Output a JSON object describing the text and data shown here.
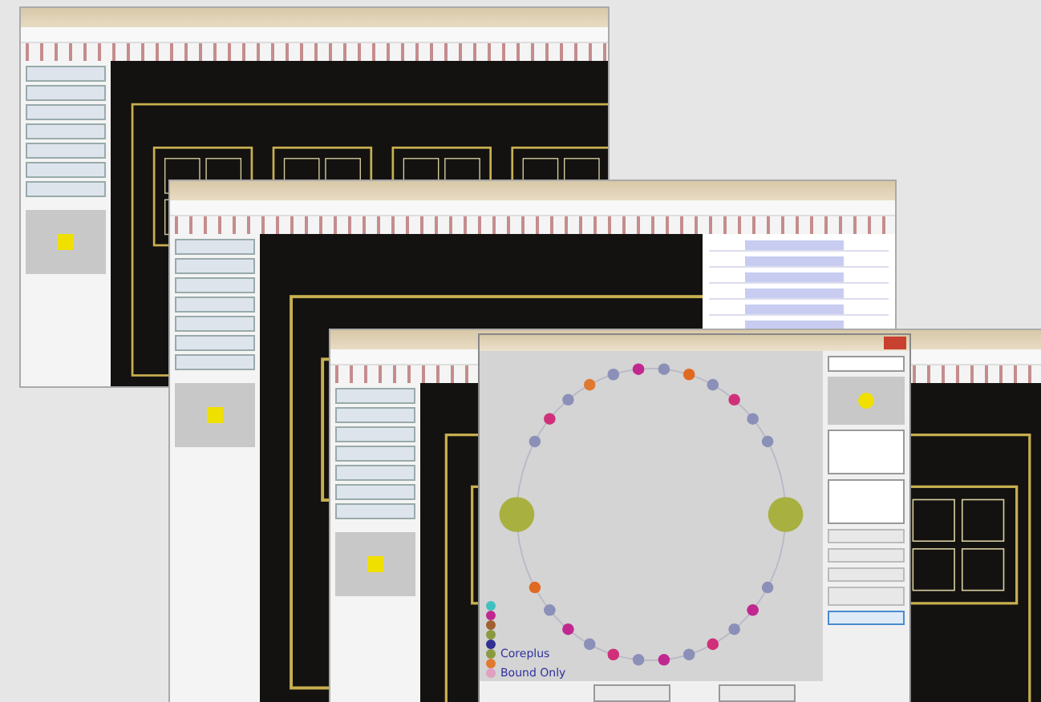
{
  "windows": [
    {
      "kind": "cad"
    },
    {
      "kind": "cad-with-list"
    },
    {
      "kind": "cad"
    }
  ],
  "dialog": {
    "pins": [
      {
        "color": "#8a90b8"
      },
      {
        "color": "#d0307a"
      },
      {
        "color": "#8a90b8"
      },
      {
        "color": "#e07a30"
      },
      {
        "color": "#8a90b8"
      },
      {
        "color": "#c02890"
      },
      {
        "color": "#8a90b8"
      },
      {
        "color": "#e06a20"
      },
      {
        "color": "#8a90b8"
      },
      {
        "color": "#d0307a"
      },
      {
        "color": "#8a90b8"
      },
      {
        "color": "#8a90b8"
      },
      {
        "color": "#8a90b8"
      },
      {
        "color": "#c02890"
      },
      {
        "color": "#8a90b8"
      },
      {
        "color": "#d0307a"
      },
      {
        "color": "#8a90b8"
      },
      {
        "color": "#c02890"
      },
      {
        "color": "#8a90b8"
      },
      {
        "color": "#d0307a"
      },
      {
        "color": "#8a90b8"
      },
      {
        "color": "#c02890"
      },
      {
        "color": "#8a90b8"
      },
      {
        "color": "#e06a20"
      }
    ],
    "nodes": [
      {
        "color": "#a8b040"
      },
      {
        "color": "#a8b040"
      }
    ],
    "legend": [
      {
        "color": "#40c0c0"
      },
      {
        "color": "#c02890"
      },
      {
        "color": "#a06030"
      },
      {
        "color": "#8a9a40"
      },
      {
        "color": "#303090"
      },
      {
        "color": "#8a9a40",
        "label": "Coreplus"
      },
      {
        "color": "#e07a30"
      },
      {
        "color": "#e0a0c0",
        "label": "Bound Only"
      }
    ]
  }
}
